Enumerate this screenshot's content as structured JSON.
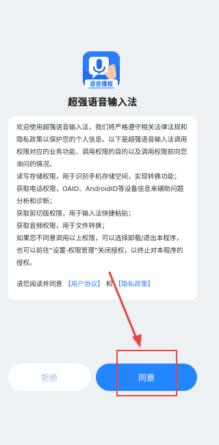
{
  "app": {
    "name": "超强语音输入法",
    "logo_caption": "语音播报"
  },
  "notice": {
    "paragraphs": [
      "欢迎使用超强语音输入法，我们将严格遵守相关法律法规和隐私政策以保护您的个人信息。以下是超强语音输入法调用权限对应的业务功能、调用权限的目的以及调用权限前向您询问的情况。",
      "读写存储权限，用于识别手机存储空间，实现转换功能；",
      "获取电话权限，OAID、AndroidID等设备信息来辅助问题分析和诊断；",
      "获取剪切版权限，用于输入法快捷粘贴；",
      "获取音频权限，用于文件转换；",
      "如果您不同意调用以上权限，可以选择卸载/退出本程序，也可以前往“设置-权限管理”关闭授权，以终止对本程序的授权。"
    ],
    "read_prefix": "请您阅读并同意",
    "user_agreement_link": "【用户协议】",
    "and_text": "和",
    "privacy_policy_link": "【隐私政策】"
  },
  "buttons": {
    "refuse_label": "拒绝",
    "agree_label": "同意"
  },
  "colors": {
    "accent": "#2486ff",
    "link": "#2f7cf6",
    "annotation": "#e9433f",
    "background": "#eef1f4"
  }
}
